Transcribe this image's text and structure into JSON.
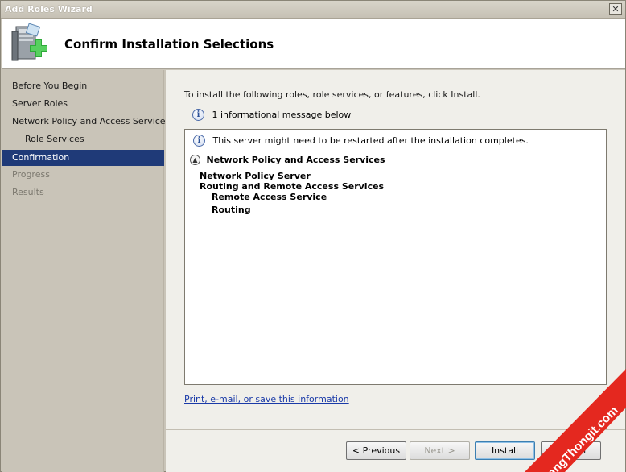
{
  "window": {
    "title": "Add Roles Wizard",
    "close_symbol": "✕"
  },
  "header": {
    "title": "Confirm Installation Selections",
    "icon": "server-roles-add-icon"
  },
  "sidebar": {
    "items": [
      {
        "label": "Before You Begin",
        "state": "normal"
      },
      {
        "label": "Server Roles",
        "state": "normal"
      },
      {
        "label": "Network Policy and Access Services",
        "state": "normal"
      },
      {
        "label": "Role Services",
        "state": "normal"
      },
      {
        "label": "Confirmation",
        "state": "active"
      },
      {
        "label": "Progress",
        "state": "disabled"
      },
      {
        "label": "Results",
        "state": "disabled"
      }
    ]
  },
  "content": {
    "intro": "To install the following roles, role services, or features, click Install.",
    "info_message": "1 informational message below",
    "details": {
      "warning": "This server might need to be restarted after the installation completes.",
      "section_title": "Network Policy and Access Services",
      "roles": [
        "Network Policy Server",
        "Routing and Remote Access Services",
        "Remote Access Service",
        "Routing"
      ]
    },
    "link": "Print, e-mail, or save this information"
  },
  "footer": {
    "previous_label": "< Previous",
    "next_label": "Next >",
    "install_label": "Install",
    "cancel_label": "Cancel"
  },
  "watermark": {
    "text": "HoangThongit.com"
  },
  "colors": {
    "active_nav": "#1f3a78",
    "link": "#1a3aa8",
    "watermark_red": "#e4281f"
  }
}
